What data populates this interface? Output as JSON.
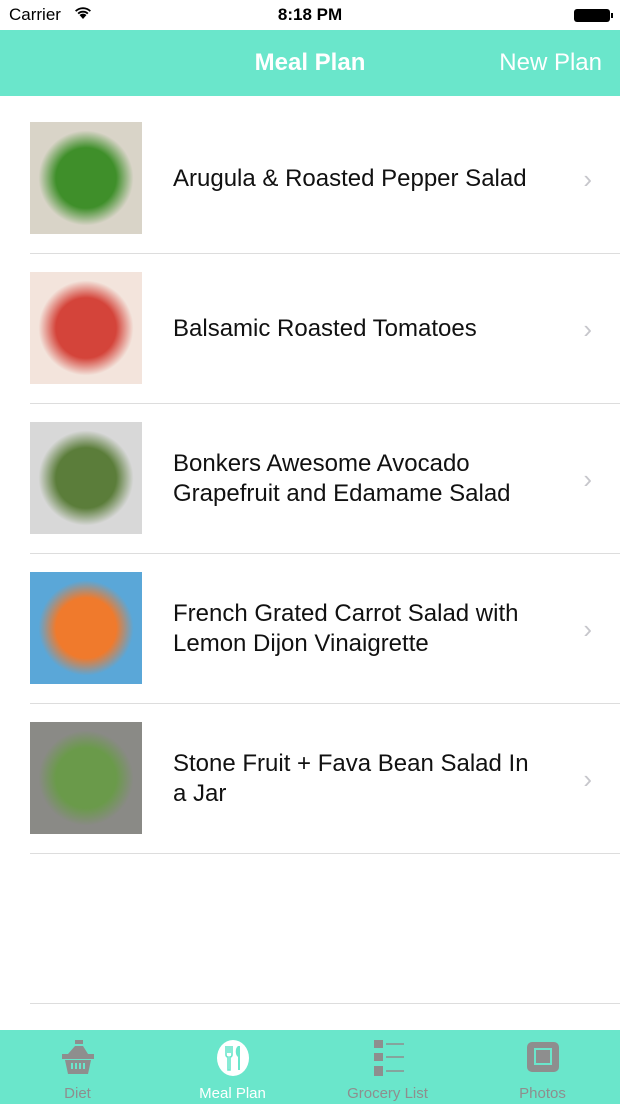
{
  "status": {
    "carrier": "Carrier",
    "time": "8:18 PM"
  },
  "nav": {
    "title": "Meal Plan",
    "new_plan": "New Plan"
  },
  "meals": [
    {
      "title": "Arugula & Roasted Pepper Salad",
      "colors": [
        "#3f8f2a",
        "#d9d4c8"
      ]
    },
    {
      "title": "Balsamic Roasted Tomatoes",
      "colors": [
        "#d4443a",
        "#f3e4dc"
      ]
    },
    {
      "title": "Bonkers Awesome Avocado Grapefruit and Edamame Salad",
      "colors": [
        "#5b7d3a",
        "#d8d8d8"
      ]
    },
    {
      "title": "French Grated Carrot Salad with Lemon Dijon Vinaigrette",
      "colors": [
        "#f07a2c",
        "#5aa7d8"
      ]
    },
    {
      "title": "Stone Fruit + Fava Bean Salad In a Jar",
      "colors": [
        "#6a9a4a",
        "#8a8a86"
      ]
    }
  ],
  "tabs": [
    {
      "label": "Diet",
      "icon": "basket-icon"
    },
    {
      "label": "Meal Plan",
      "icon": "fork-knife-icon",
      "active": true
    },
    {
      "label": "Grocery List",
      "icon": "checklist-icon"
    },
    {
      "label": "Photos",
      "icon": "photo-frame-icon"
    }
  ],
  "colors": {
    "accent": "#6ae6cb",
    "inactive": "#8e8e8e"
  }
}
